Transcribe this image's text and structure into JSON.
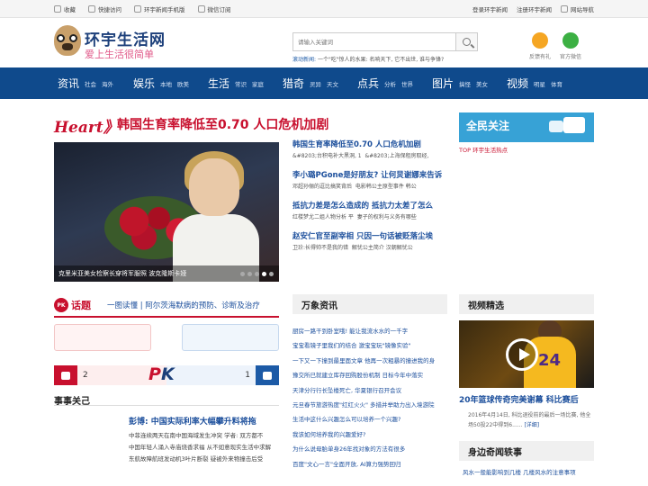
{
  "topbar": {
    "links": [
      "收藏",
      "快捷访问",
      "环宇新闻手机版",
      "微信订阅"
    ],
    "right": [
      "登录环宇新闻",
      "注册环宇新闻",
      "网站导航"
    ]
  },
  "logo": {
    "title": "环宇生活网",
    "slogan": "爱上生活很简单"
  },
  "search": {
    "placeholder": "请输入关键词"
  },
  "hotline": {
    "label": "滚动新闻:",
    "text": "一个\"吃\"惊人的水果: 名响天下, 它不出世, 谁与争锋?"
  },
  "header_icons": [
    {
      "label": "反馈有礼",
      "color": "#f5a623"
    },
    {
      "label": "官方微信",
      "color": "#3cb043"
    }
  ],
  "nav": [
    {
      "label": "资讯",
      "subs": [
        "社会",
        "海外"
      ]
    },
    {
      "label": "娱乐",
      "subs": [
        "本地",
        "欧美"
      ]
    },
    {
      "label": "生活",
      "subs": [
        "常识",
        "家庭"
      ]
    },
    {
      "label": "猎奇",
      "subs": [
        "灵异",
        "天文"
      ]
    },
    {
      "label": "点兵",
      "subs": [
        "分析",
        "世界"
      ]
    },
    {
      "label": "图片",
      "subs": [
        "搞怪",
        "美女"
      ]
    },
    {
      "label": "视频",
      "subs": [
        "明星",
        "体育"
      ]
    }
  ],
  "headline": {
    "tag": "Heart》",
    "title": "韩国生育率降低至0.70 人口危机加剧"
  },
  "hero": {
    "caption": "克里米亚美女检察长穿将军服照 波克隆斯卡娅"
  },
  "news": [
    {
      "title": "韩国生育率降低至0.70 人口危机加剧",
      "subs": [
        "&#8203;台积电补大黑洞, 1",
        "&#8203;上海保租房取经,"
      ]
    },
    {
      "title": "李小璐PGone是好朋友? 让何炅谢娜来告诉",
      "subs": [
        "邓超孙俪的逗比搞笑背后",
        "电影韩公主原型事件 韩公"
      ]
    },
    {
      "title": "抵抗力差是怎么造成的 抵抗力太差了怎么",
      "subs": [
        "红楼梦尤二姐人物分析 平",
        "妻子的权利与义务有哪些"
      ]
    },
    {
      "title": "赵安仁官至副宰相 只因一句话被贬落尘埃",
      "subs": [
        "卫玠:长得帅不是我的错",
        "解忧公主简介 汉朝解忧公"
      ]
    }
  ],
  "ad": {
    "title": "全民关注",
    "topline": "TOP 环宇生活热点"
  },
  "pk": {
    "badge": "PK",
    "topic": "话题",
    "sub": "一图读懂 | 阿尔茨海默病的预防、诊断及治疗",
    "left_count": "2",
    "right_count": "1",
    "pk_p": "P",
    "pk_k": "K"
  },
  "guan": {
    "title": "事事关己",
    "head": "彭博: 中国实际利率大幅攀升料将拖",
    "items": [
      "中菲连续两天在南中国海域发生冲突 学者: 双方都不",
      "中国年轻人涌入寺庙烧香求福 从不如意现实生活中求解",
      "东航故障航班发动机3叶片断裂 疑被外来物撞击后受"
    ]
  },
  "wanxiang": {
    "title": "万象资讯",
    "items": [
      "厨房一路干到卧室哦! 能让我流水水的一千字",
      "宝宝看镜子里我们的结合 激宝宝玩\"镜像实验\"",
      "一下又一下撞到最里面文章 他再一次粗暴的撞进我的身",
      "豫交所已就建立库存回购股份机制 日标今年中落实",
      "天津分行行长坠楼死亡, 华夏银行召开会议",
      "元旦春节旅游热度\"红红火火\" 多措并举助力出入境游院",
      "生活中这什么兴趣怎么可以培养一个兴趣?",
      "我该如何培养我的兴趣爱好?",
      "为什么说母胎单身26年找对象的方法有很多",
      "百度\"文心一言\"全面开放, AI算力强势回归"
    ]
  },
  "video": {
    "title": "视频精选",
    "number": "24",
    "caption": "20年篮球传奇完美谢幕 科比赛后",
    "desc": "2016年4月14日, 科比退役前的最后一场比赛, 他全场50投22中得到6......",
    "more": "[详细]"
  },
  "qiwen": {
    "title": "身边奇闻轶事",
    "item": "风水一般能影响到几楼 几楼风水的注意事项"
  }
}
